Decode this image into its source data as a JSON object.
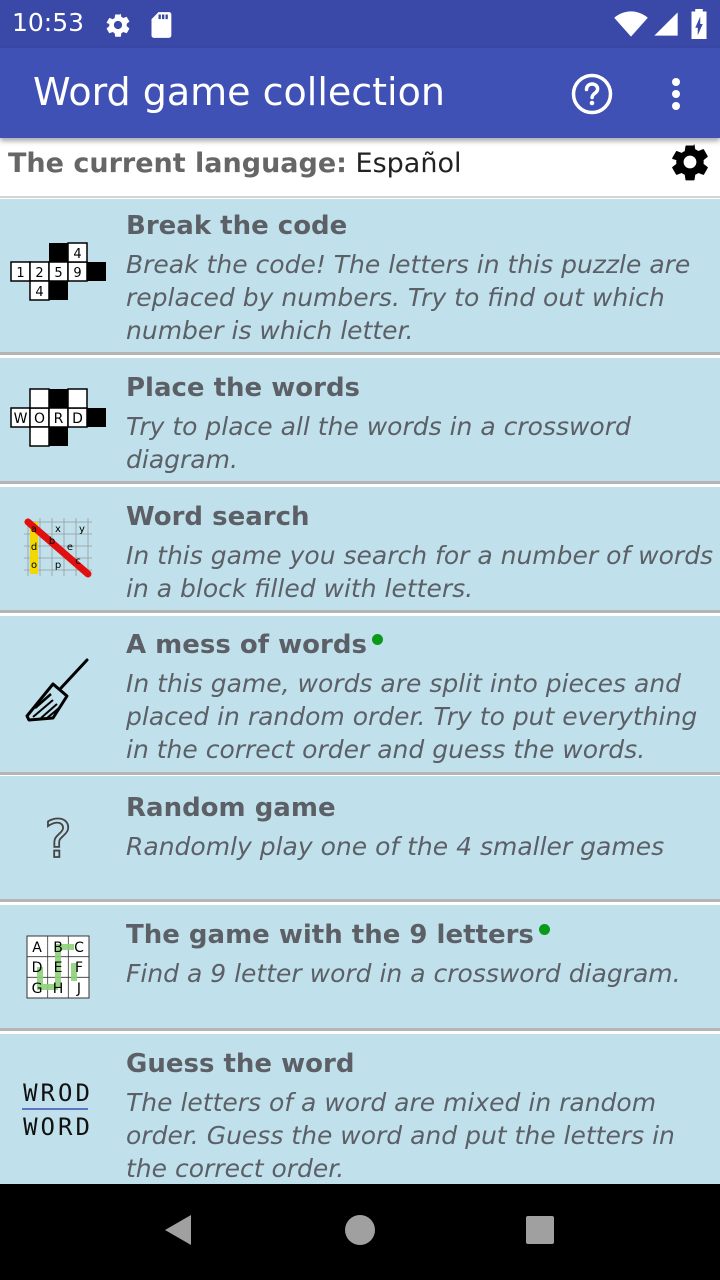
{
  "status_bar": {
    "time": "10:53",
    "icons": [
      "settings-gear-icon",
      "sd-card-icon",
      "wifi-icon",
      "signal-icon",
      "battery-charging-icon"
    ]
  },
  "app_bar": {
    "title": "Word game collection",
    "actions": [
      "help-icon",
      "more-vert-icon"
    ]
  },
  "language": {
    "label": "The current language:",
    "value": "Español",
    "settings_icon": "gear-icon"
  },
  "games": [
    {
      "title": "Break the code",
      "description": "Break the code! The letters in this puzzle are replaced by numbers. Try to find out which number is which letter.",
      "icon": "break-the-code-icon",
      "icon_text": [
        "4",
        "1",
        "2",
        "5",
        "9",
        "4"
      ],
      "is_new": false
    },
    {
      "title": "Place the words",
      "description": "Try to place all the words in a crossword diagram.",
      "icon": "place-words-icon",
      "icon_text": [
        "W",
        "O",
        "R",
        "D"
      ],
      "is_new": false
    },
    {
      "title": "Word search",
      "description": "In this game you search for a number of words in a block filled with letters.",
      "icon": "word-search-icon",
      "icon_text": [
        "a",
        "x",
        "y",
        "d",
        "b",
        "e",
        "o",
        "p",
        "c"
      ],
      "is_new": false
    },
    {
      "title": "A mess of words",
      "description": "In this game, words are split into pieces and placed in random order. Try to put everything in the correct order and guess the words.",
      "icon": "broom-icon",
      "is_new": true
    },
    {
      "title": "Random game",
      "description": "Randomly play one of the 4 smaller games",
      "icon": "question-mark-icon",
      "icon_text": [
        "?"
      ],
      "is_new": false
    },
    {
      "title": "The game with the 9 letters",
      "description": "Find a 9 letter word in a crossword diagram.",
      "icon": "nine-letters-icon",
      "icon_text": [
        "A",
        "B",
        "C",
        "D",
        "E",
        "F",
        "G",
        "H",
        "J"
      ],
      "is_new": true
    },
    {
      "title": "Guess the word",
      "description": "The letters of a word are mixed in random order. Guess the word and put the letters in the correct order.",
      "icon": "guess-word-icon",
      "icon_text": [
        "WROD",
        "WORD"
      ],
      "is_new": false
    }
  ],
  "nav_bar": {
    "buttons": [
      "back-icon",
      "home-icon",
      "recents-icon"
    ]
  },
  "colors": {
    "status_bar": "#3a48a8",
    "app_bar": "#3f51b5",
    "list_item_bg": "#c0e1ec",
    "text": "#5c6066",
    "new_dot": "#0a9a1a"
  }
}
